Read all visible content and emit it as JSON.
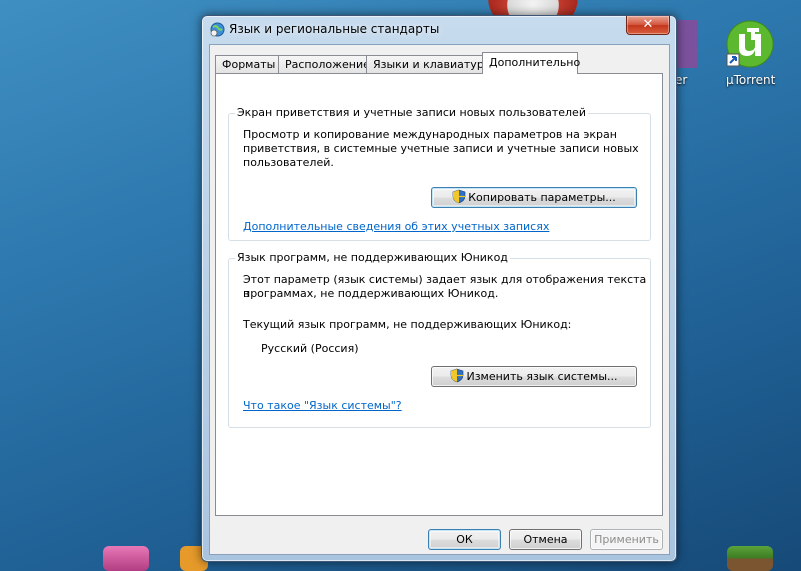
{
  "window": {
    "title": "Язык и региональные стандарты",
    "close_glyph": "✕"
  },
  "tabs": [
    {
      "label": "Форматы"
    },
    {
      "label": "Расположение"
    },
    {
      "label": "Языки и клавиатуры"
    },
    {
      "label": "Дополнительно",
      "selected": true
    }
  ],
  "welcome_group": {
    "legend": "Экран приветствия и учетные записи новых пользователей",
    "description_lines": [
      "Просмотр и копирование международных параметров на экран",
      "приветствия, в системные учетные записи и учетные записи новых",
      "пользователей."
    ],
    "copy_button": "Копировать параметры...",
    "more_info_link": "Дополнительные сведения об этих учетных записях"
  },
  "unicode_group": {
    "legend": "Язык программ, не поддерживающих Юникод",
    "description_lines": [
      "Этот параметр (язык системы) задает язык для отображения текста в",
      "программах, не поддерживающих Юникод."
    ],
    "current_label": "Текущий язык программ, не поддерживающих Юникод:",
    "current_value": "Русский (Россия)",
    "change_button": "Изменить язык системы...",
    "what_is_link": "Что такое \"Язык системы\"?"
  },
  "footer": {
    "ok": "ОК",
    "cancel": "Отмена",
    "apply": "Применить"
  },
  "desktop": {
    "utorrent_label": "µTorrent",
    "partial_label": "er"
  },
  "colors": {
    "link": "#0066cc",
    "utorrent_green": "#5cb82e",
    "close_red": "#c3361c"
  }
}
